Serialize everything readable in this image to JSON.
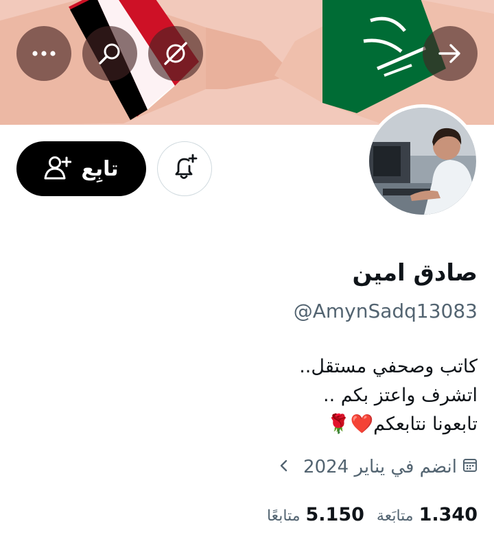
{
  "header": {
    "back_icon": "arrow-right-icon",
    "grok_icon": "grok-icon",
    "search_icon": "search-icon",
    "more_icon": "more-dots-icon"
  },
  "banner": {
    "description_colors": {
      "skin": "#f2c9bb",
      "yemen_red": "#ce1126",
      "yemen_white": "#ffffff",
      "yemen_black": "#000000",
      "saudi_green": "#006c35"
    }
  },
  "profile": {
    "display_name": "صادق امين",
    "handle": "@AmynSadq13083",
    "bio_lines": [
      "كاتب وصحفي مستقل..",
      "اتشرف واعتز بكم ..",
      "تابعونا نتابعكم❤️🌹"
    ],
    "joined": "انضم في يناير 2024",
    "following_count": "1.340",
    "following_label": "متابَعة",
    "followers_count": "5.150",
    "followers_label": "متابعًا"
  },
  "actions": {
    "follow_label": "تابِع",
    "follow_icon": "add-user-icon",
    "notify_icon": "bell-plus-icon"
  },
  "colors": {
    "primary_text": "#0f1419",
    "secondary_text": "#536471",
    "button_bg": "#000000",
    "border": "#cfd9de"
  }
}
